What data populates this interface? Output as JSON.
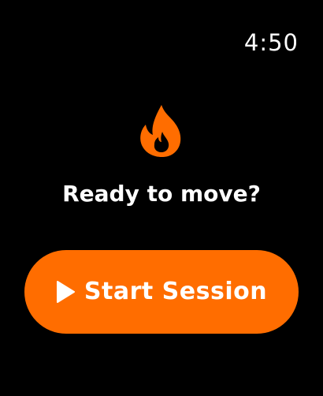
{
  "status": {
    "time": "4:50"
  },
  "colors": {
    "accent": "#FF6D00",
    "background": "#000000",
    "text": "#FFFFFF"
  },
  "hero": {
    "icon": "flame-icon",
    "title": "Ready to move?"
  },
  "start_button": {
    "icon": "play-icon",
    "label": "Start Session"
  }
}
